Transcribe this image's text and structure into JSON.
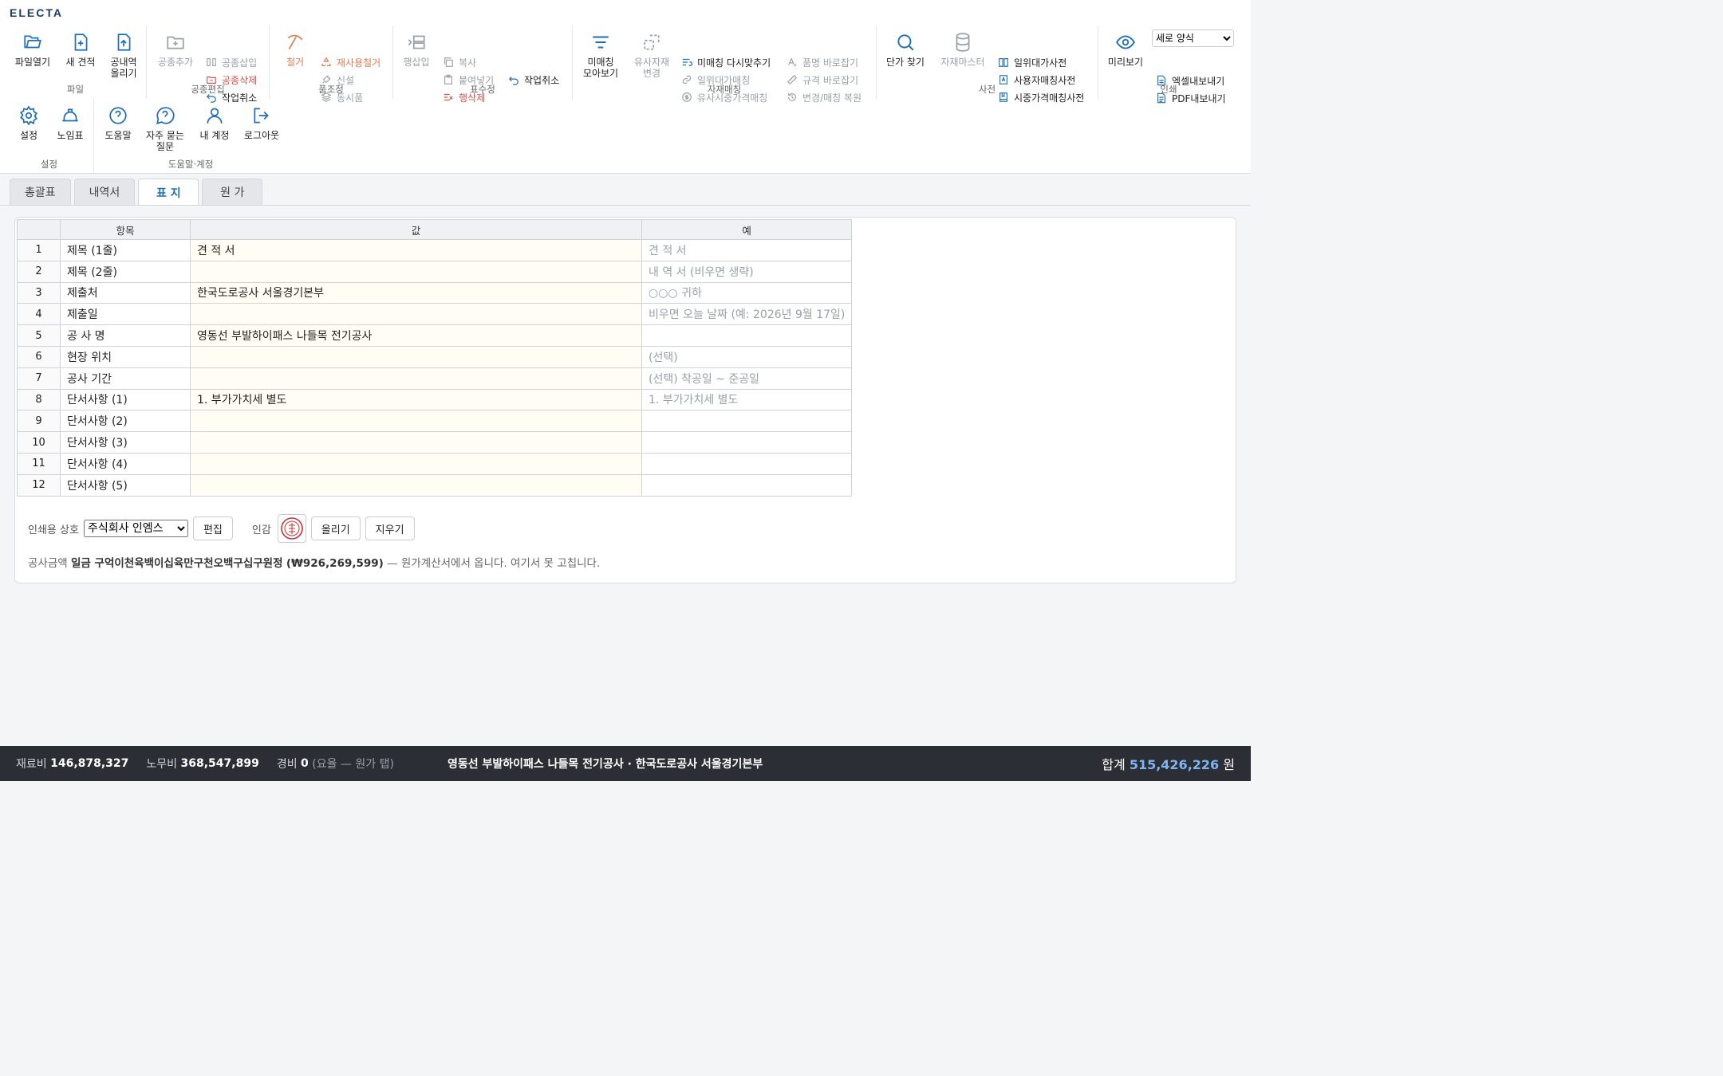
{
  "app": {
    "logo": "ELECTA"
  },
  "ribbon": {
    "file": {
      "label": "파일",
      "open": "파일열기",
      "new": "새 견적",
      "upload1": "공내역",
      "upload2": "올리기"
    },
    "trade": {
      "label": "공종편집",
      "add": "공종추가",
      "insert": "공종삽입",
      "delete": "공종삭제",
      "undo": "작업취소"
    },
    "item": {
      "label": "품조정",
      "remove": "철거",
      "reuse": "재사용철거",
      "newinst": "신설",
      "same": "동시품"
    },
    "table": {
      "label": "표수정",
      "rowins": "행삽입",
      "copy": "복사",
      "paste": "붙여넣기",
      "rowdel": "행삭제",
      "undo": "작업취소"
    },
    "material": {
      "label": "자재매칭",
      "unmatched1": "미매칭",
      "unmatched2": "모아보기",
      "similar1": "유사자재",
      "similar2": "변경",
      "rematch": "미매칭 다시맞추기",
      "unitmatch": "일위대가매칭",
      "pricematch": "유사시중가격매칭",
      "namefix": "품명 바로잡기",
      "specfix": "규격 바로잡기",
      "restore": "변경/매칭 복원"
    },
    "dict": {
      "label": "사전",
      "find": "단가 찾기",
      "master": "자재마스터",
      "unitdict": "일위대가사전",
      "userdict": "사용자매칭사전",
      "pricedict": "시중가격매칭사전"
    },
    "print": {
      "label": "인쇄",
      "preview": "미리보기",
      "layout": "세로 양식",
      "excel": "엑셀내보내기",
      "pdf": "PDF내보내기"
    },
    "settings": {
      "label": "설정",
      "settings": "설정",
      "labor": "노임표"
    },
    "help": {
      "label": "도움말·계정",
      "help": "도움말",
      "faq1": "자주 묻는",
      "faq2": "질문",
      "account": "내 계정",
      "logout": "로그아웃"
    }
  },
  "tabs": [
    "총괄표",
    "내역서",
    "표 지",
    "원 가"
  ],
  "grid": {
    "headers": [
      "항목",
      "값",
      "예"
    ],
    "rows": [
      {
        "n": "1",
        "item": "제목 (1줄)",
        "value": "견 적 서",
        "example": "견 적 서"
      },
      {
        "n": "2",
        "item": "제목 (2줄)",
        "value": "",
        "example": "내 역 서 (비우면 생략)"
      },
      {
        "n": "3",
        "item": "제출처",
        "value": "한국도로공사 서울경기본부",
        "example": "○○○ 귀하"
      },
      {
        "n": "4",
        "item": "제출일",
        "value": "",
        "example": "비우면 오늘 날짜 (예: 2026년 9월 17일)"
      },
      {
        "n": "5",
        "item": "공 사 명",
        "value": "영동선 부발하이패스 나들목 전기공사",
        "example": ""
      },
      {
        "n": "6",
        "item": "현장 위치",
        "value": "",
        "example": "(선택)"
      },
      {
        "n": "7",
        "item": "공사 기간",
        "value": "",
        "example": "(선택) 착공일 ~ 준공일"
      },
      {
        "n": "8",
        "item": "단서사항 (1)",
        "value": "1. 부가가치세 별도",
        "example": "1. 부가가치세 별도"
      },
      {
        "n": "9",
        "item": "단서사항 (2)",
        "value": "",
        "example": ""
      },
      {
        "n": "10",
        "item": "단서사항 (3)",
        "value": "",
        "example": ""
      },
      {
        "n": "11",
        "item": "단서사항 (4)",
        "value": "",
        "example": ""
      },
      {
        "n": "12",
        "item": "단서사항 (5)",
        "value": "",
        "example": ""
      }
    ]
  },
  "stamp": {
    "company_label": "인쇄용 상호",
    "company": "주식회사 인엠스",
    "edit": "편집",
    "seal_label": "인감",
    "upload": "올리기",
    "clear": "지우기"
  },
  "amount": {
    "label": "공사금액",
    "words": "일금 구억이천육백이십육만구천오백구십구원정",
    "number": "(₩926,269,599)",
    "note": "— 원가계산서에서 옵니다. 여기서 못 고칩니다."
  },
  "footer": {
    "material_label": "재료비",
    "material": "146,878,327",
    "labor_label": "노무비",
    "labor": "368,547,899",
    "expense_label": "경비",
    "expense": "0",
    "expense_note": "(요율 — 원가 탭)",
    "project": "영동선 부발하이패스 나들목 전기공사 · 한국도로공사 서울경기본부",
    "total_label": "합계",
    "total": "515,426,226",
    "unit": "원"
  },
  "colors": {
    "accent": "#1f6fb8",
    "brand": "#1f3a6b",
    "footer_bg": "#2b2f35",
    "total": "#7fb4ef"
  }
}
